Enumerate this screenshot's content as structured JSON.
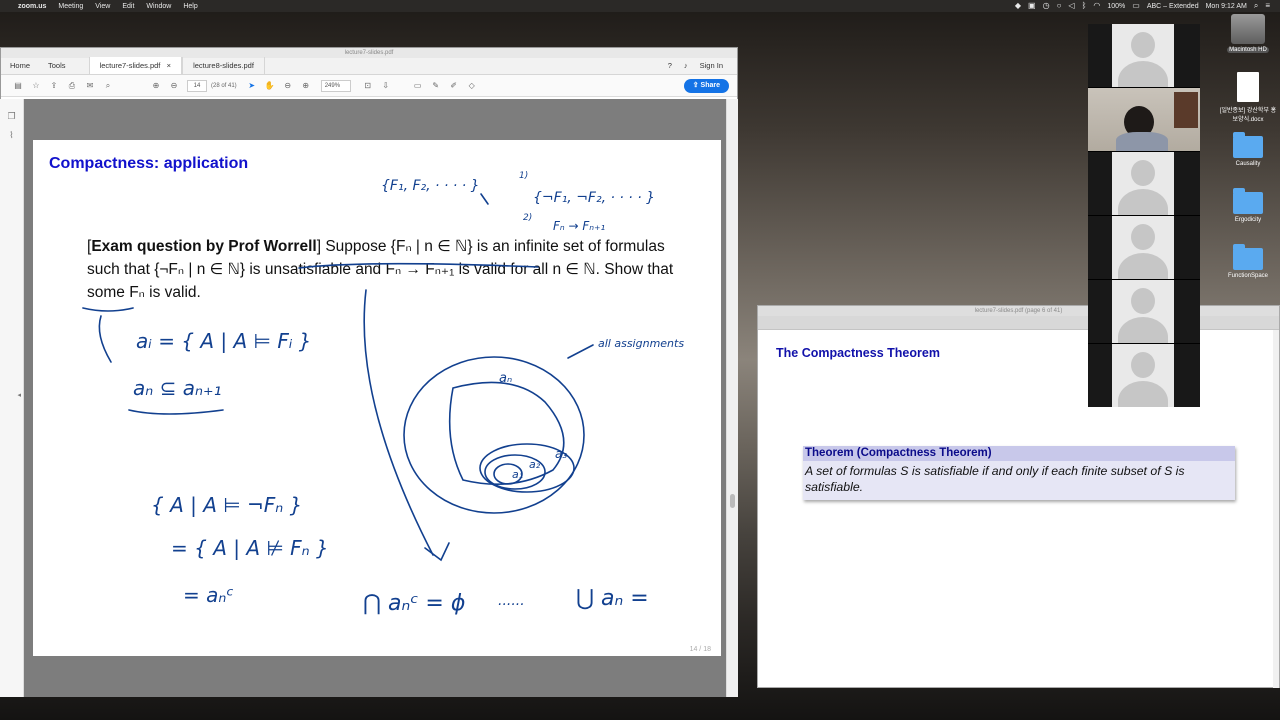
{
  "menubar": {
    "app": "zoom.us",
    "menus": [
      "Meeting",
      "View",
      "Edit",
      "Window",
      "Help"
    ],
    "battery": "100%",
    "input_source": "ABC – Extended",
    "clock": "Mon 9:12 AM"
  },
  "acrobat": {
    "window_title": "lecture7-slides.pdf",
    "nav": [
      "Home",
      "Tools"
    ],
    "tabs": [
      {
        "label": "lecture7-slides.pdf"
      },
      {
        "label": "lecture8-slides.pdf"
      }
    ],
    "tab_close": "×",
    "signin": "Sign In",
    "page_current": "14",
    "page_of": "(28 of 41)",
    "zoom": "249%",
    "share": "Share"
  },
  "slide": {
    "title": "Compactness: application",
    "exam": {
      "bold": "Exam question by Prof Worrell",
      "text": "Suppose {Fₙ | n ∈ ℕ} is an infinite set of formulas such that {¬Fₙ | n ∈ ℕ} is unsatisfiable and Fₙ → Fₙ₊₁ is valid for all n ∈ ℕ. Show that some Fₙ is valid."
    },
    "page_num": "14 / 18",
    "handwriting": {
      "h1": "{F₁, F₂, · · · · }",
      "h2": "1)",
      "h3": "{¬F₁, ¬F₂, · · · · }",
      "h4": "2)",
      "h5": "Fₙ → Fₙ₊₁",
      "h6": "aᵢ = { A | A ⊨ Fᵢ }",
      "h7": "aₙ ⊆ aₙ₊₁",
      "h8": "all assignments",
      "h9": "aₙ",
      "h10": "a₃",
      "h11": "a₂",
      "h12": "a₁",
      "h13": "{ A | A ⊨ ¬Fₙ }",
      "h14": "= { A | A ⊭ Fₙ }",
      "h15": "=  aₙᶜ",
      "h16": "⋂ aₙᶜ = ϕ",
      "h17": "......",
      "h18": "⋃ aₙ ="
    }
  },
  "second_window": {
    "title": "lecture7-slides.pdf (page 6 of 41)",
    "heading": "The Compactness Theorem",
    "theorem_head": "Theorem (Compactness Theorem)",
    "theorem_body": "A set of formulas S is satisfiable if and only if each finite subset of S is satisfiable."
  },
  "desktop": {
    "icons": [
      {
        "label": "Macintosh HD"
      },
      {
        "label": "[일반종보] 강산학부 홍보양식.docx"
      },
      {
        "label": "Causality"
      },
      {
        "label": "Ergodicity"
      },
      {
        "label": "FunctionSpace"
      }
    ]
  }
}
